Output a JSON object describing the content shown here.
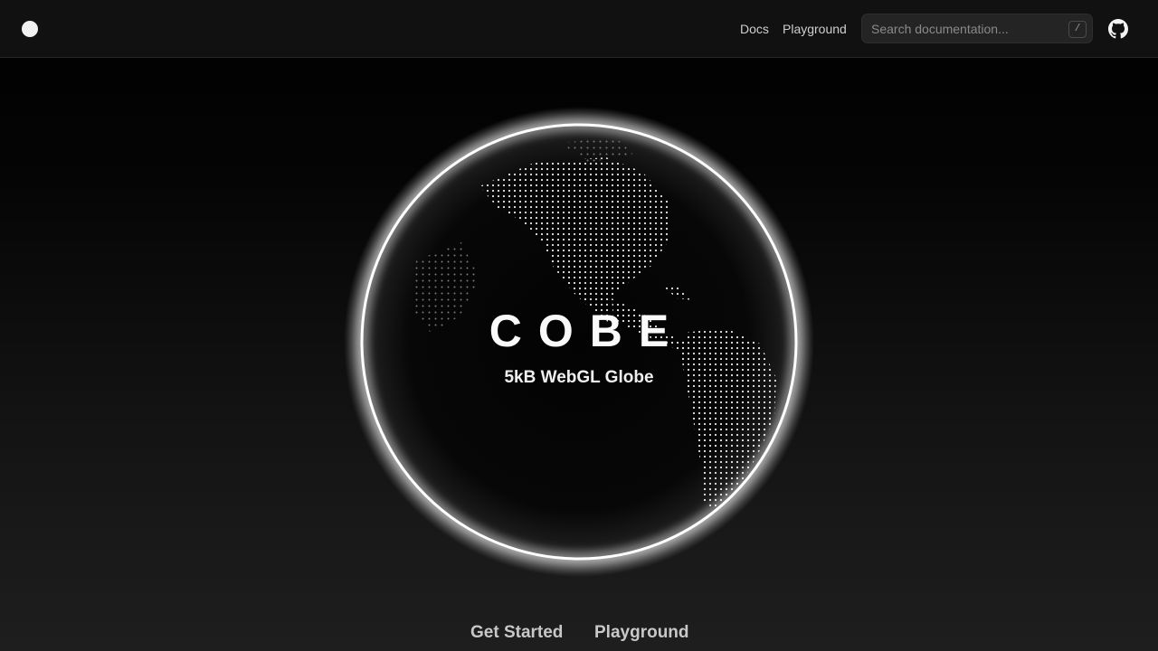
{
  "header": {
    "nav": {
      "docs": "Docs",
      "playground": "Playground"
    },
    "search": {
      "placeholder": "Search documentation...",
      "shortcut": "/"
    },
    "icons": {
      "logo": "circle-logo-icon",
      "github": "github-icon"
    }
  },
  "hero": {
    "title": "COBE",
    "subtitle": "5kB WebGL Globe"
  },
  "actions": {
    "get_started": "Get Started",
    "playground": "Playground"
  },
  "colors": {
    "background": "#000000",
    "header_bg": "#111111",
    "globe_rim": "#ffffff",
    "text": "#fafafa"
  }
}
